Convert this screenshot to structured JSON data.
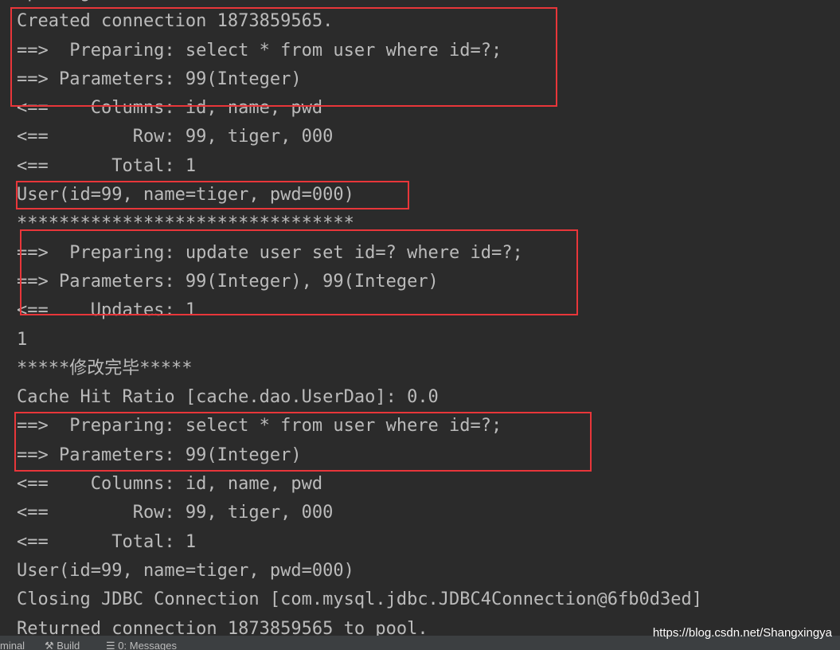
{
  "console": {
    "lines": [
      "Opening JDBC Connection",
      "Created connection 1873859565.",
      "==>  Preparing: select * from user where id=?;",
      "==> Parameters: 99(Integer)",
      "<==    Columns: id, name, pwd",
      "<==        Row: 99, tiger, 000",
      "<==      Total: 1",
      "User(id=99, name=tiger, pwd=000)",
      "********************************",
      "==>  Preparing: update user set id=? where id=?;",
      "==> Parameters: 99(Integer), 99(Integer)",
      "<==    Updates: 1",
      "1",
      "*****修改完毕*****",
      "Cache Hit Ratio [cache.dao.UserDao]: 0.0",
      "==>  Preparing: select * from user where id=?;",
      "==> Parameters: 99(Integer)",
      "<==    Columns: id, name, pwd",
      "<==        Row: 99, tiger, 000",
      "<==      Total: 1",
      "User(id=99, name=tiger, pwd=000)",
      "Closing JDBC Connection [com.mysql.jdbc.JDBC4Connection@6fb0d3ed]",
      "Returned connection 1873859565 to pool."
    ]
  },
  "highlight_color": "#e8363a",
  "statusbar": {
    "terminal": "minal",
    "build": "Build",
    "messages": "0: Messages"
  },
  "watermark": "https://blog.csdn.net/Shangxingya"
}
